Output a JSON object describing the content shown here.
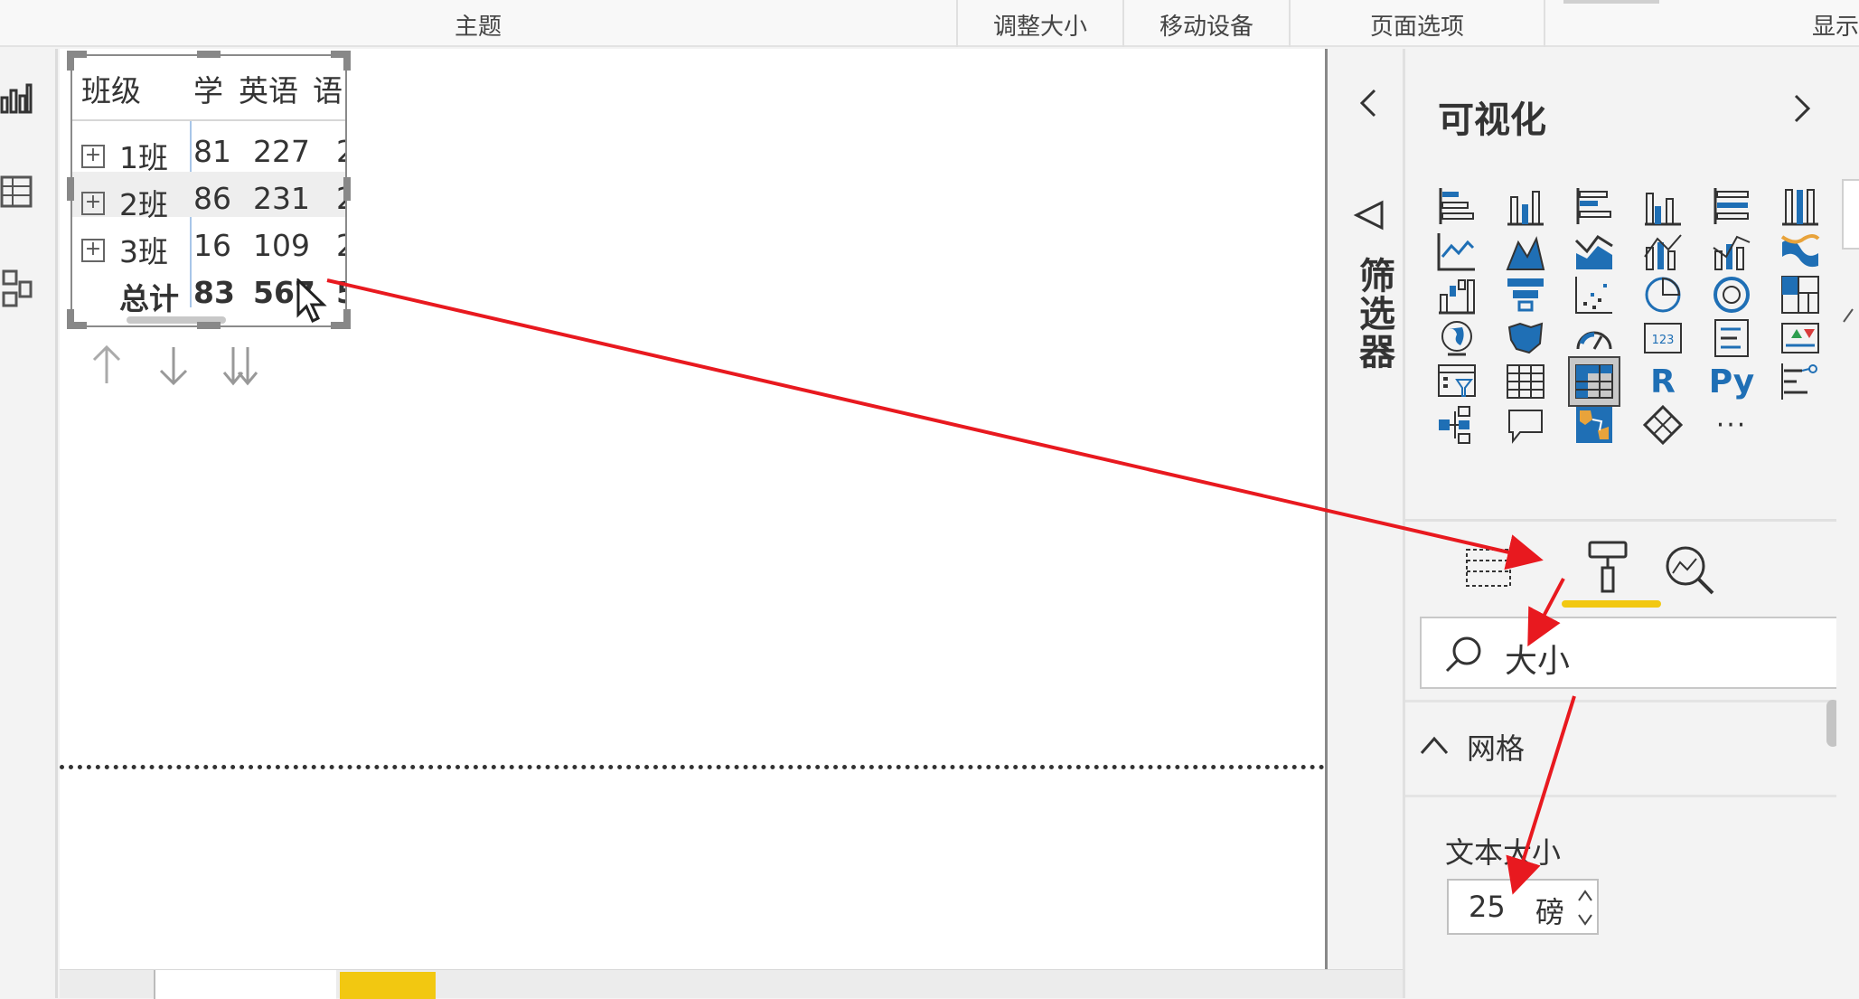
{
  "ribbon": {
    "groups": [
      "主题",
      "调整大小",
      "移动设备",
      "页面选项",
      "显示"
    ]
  },
  "table": {
    "headers": [
      "班级",
      "学",
      "英语",
      "语"
    ],
    "rows": [
      {
        "class": "1班",
        "c1": "81",
        "c2": "227",
        "c3": "2"
      },
      {
        "class": "2班",
        "c1": "86",
        "c2": "231",
        "c3": "2"
      },
      {
        "class": "3班",
        "c1": "16",
        "c2": "109",
        "c3": "2"
      }
    ],
    "total": {
      "label": "总计",
      "c1": "83",
      "c2": "567",
      "c3": "5"
    }
  },
  "filters": {
    "title": "筛选器"
  },
  "visualizations": {
    "title": "可视化",
    "r_label": "R",
    "py_label": "Py",
    "more_label": "···",
    "search_value": "大小",
    "grid_section": "网格",
    "text_size_label": "文本大小",
    "text_size_value": "25",
    "text_size_unit": "磅"
  },
  "colors": {
    "accent_yellow": "#f2c811",
    "icon_blue": "#1f6fb5",
    "annotation_red": "#e8191f"
  }
}
